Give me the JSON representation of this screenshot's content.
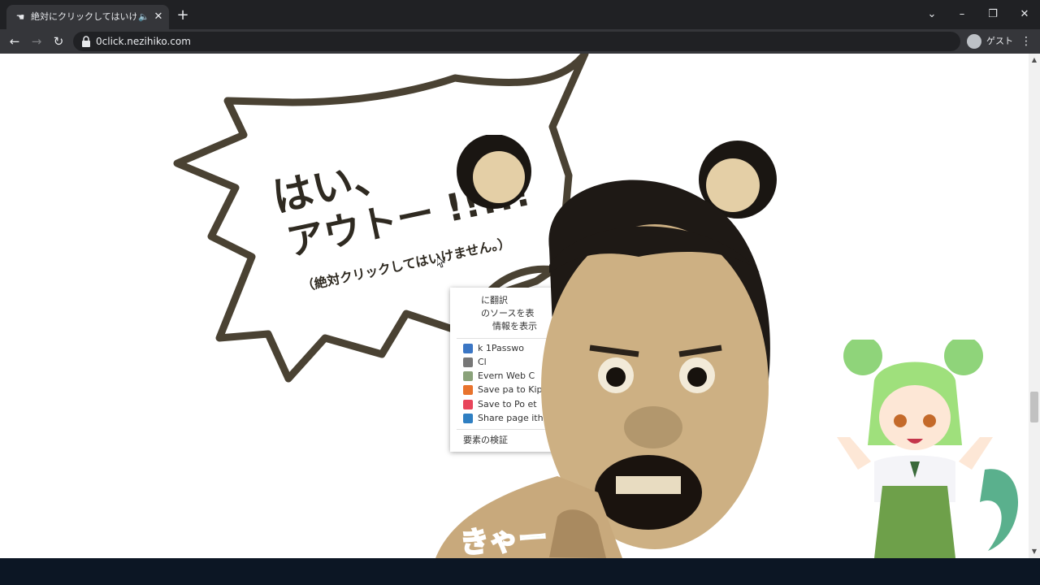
{
  "tab": {
    "title": "絶対にクリックしてはいけないサイ",
    "favicon_icon": "hand-cursor-icon",
    "audio_icon": "speaker-icon",
    "close_icon": "close-icon"
  },
  "newtab_icon": "plus-icon",
  "window_controls": [
    "chevron-down-icon",
    "minimize-icon",
    "restore-icon",
    "close-icon"
  ],
  "toolbar": {
    "back_icon": "back-arrow-icon",
    "forward_icon": "forward-arrow-icon",
    "reload_icon": "reload-icon",
    "url": "0click.nezihiko.com",
    "profile_label": "ゲスト",
    "menu_icon": "kebab-menu-icon"
  },
  "page": {
    "headline_1": "はい、",
    "headline_2": "アウトー !!!!!",
    "subline": "（絶対クリックしてはいけません。）",
    "caption": "きゃー"
  },
  "context_menu": {
    "items": [
      {
        "label": "に翻訳",
        "icon": null
      },
      {
        "label": "のソースを表",
        "icon": null
      },
      {
        "label": "情報を表示",
        "icon": null
      },
      {
        "label": "k 1Passwo",
        "icon": "1password-icon"
      },
      {
        "label": "Cl",
        "icon": "clip-icon"
      },
      {
        "label": "Evern     Web C",
        "icon": "evernote-icon"
      },
      {
        "label": "Save pa   to Kip",
        "icon": "kippt-icon"
      },
      {
        "label": "Save to Po   et",
        "icon": "pocket-icon"
      },
      {
        "label": "Share page  ith T",
        "icon": "twitter-icon"
      },
      {
        "label": "要素の検証",
        "icon": null
      }
    ]
  },
  "colors": {
    "bubble_outline": "#4a4233",
    "headline": "#2f2a21",
    "caption": "#8ee06e",
    "chrome_bg": "#202124",
    "toolbar_bg": "#35363a"
  }
}
